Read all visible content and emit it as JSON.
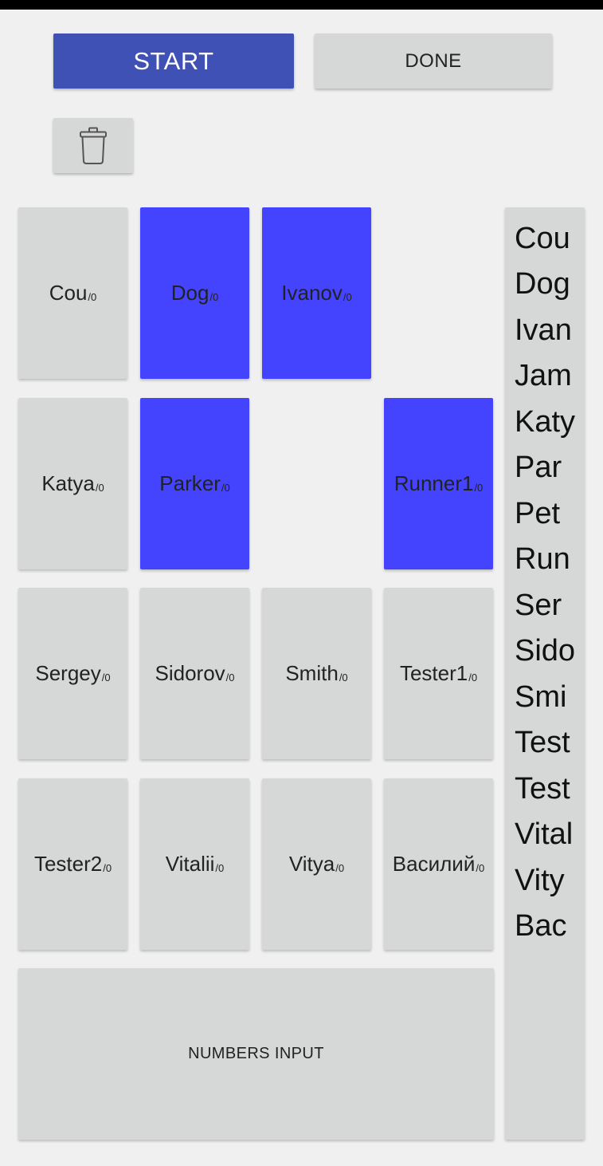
{
  "toolbar": {
    "start_label": "START",
    "done_label": "DONE",
    "trash_icon": "trash-can-icon"
  },
  "colors": {
    "start_button": "#3f51b5",
    "active_tile": "#4444ff",
    "inactive_tile": "#d6d7d7",
    "background": "#f0f0f0"
  },
  "tiles": [
    {
      "name": "Cou",
      "count": "/0",
      "active": false
    },
    {
      "name": "Dog",
      "count": "/0",
      "active": true
    },
    {
      "name": "Ivanov",
      "count": "/0",
      "active": true
    },
    {
      "name": "Katya",
      "count": "/0",
      "active": false
    },
    {
      "name": "Parker",
      "count": "/0",
      "active": true
    },
    {
      "name": "Runner1",
      "count": "/0",
      "active": true
    },
    {
      "name": "Sergey",
      "count": "/0",
      "active": false
    },
    {
      "name": "Sidorov",
      "count": "/0",
      "active": false
    },
    {
      "name": "Smith",
      "count": "/0",
      "active": false
    },
    {
      "name": "Tester1",
      "count": "/0",
      "active": false
    },
    {
      "name": "Tester2",
      "count": "/0",
      "active": false
    },
    {
      "name": "Vitalii",
      "count": "/0",
      "active": false
    },
    {
      "name": "Vitya",
      "count": "/0",
      "active": false
    },
    {
      "name": "Василий",
      "count": "/0",
      "active": false
    }
  ],
  "numbers_input_label": "NUMBERS INPUT",
  "side_list": [
    "Cou",
    "Dog",
    "Ivan",
    "Jam",
    "Katy",
    "Par",
    "Pet",
    "Run",
    "Ser",
    "Sido",
    "Smi",
    "Test",
    "Test",
    "Vital",
    "Vity",
    "Вас"
  ]
}
